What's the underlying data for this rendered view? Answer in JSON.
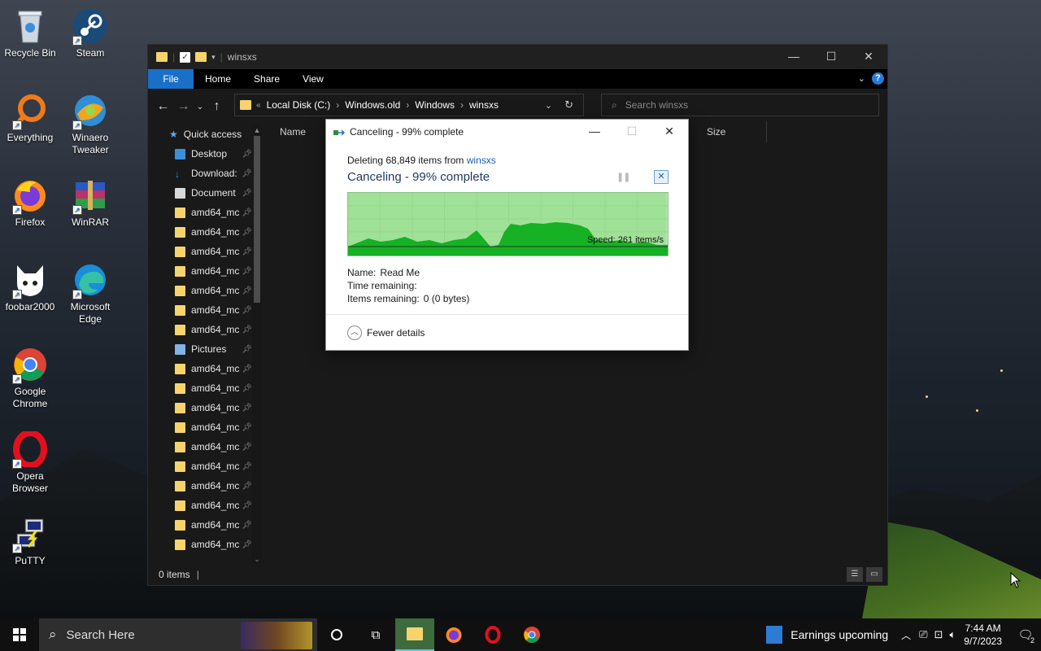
{
  "desktop": {
    "icons": [
      {
        "label": "Recycle Bin"
      },
      {
        "label": "Steam"
      },
      {
        "label": "Everything"
      },
      {
        "label": "Winaero Tweaker"
      },
      {
        "label": "Firefox"
      },
      {
        "label": "WinRAR"
      },
      {
        "label": "foobar2000"
      },
      {
        "label": "Microsoft Edge"
      },
      {
        "label": "Google Chrome"
      },
      {
        "label": "Opera Browser"
      },
      {
        "label": "PuTTY"
      }
    ]
  },
  "explorer": {
    "title": "winsxs",
    "ribbon": {
      "file": "File",
      "home": "Home",
      "share": "Share",
      "view": "View"
    },
    "address": {
      "overflow": "«",
      "path": [
        "Local Disk (C:)",
        "Windows.old",
        "Windows",
        "winsxs"
      ]
    },
    "search_placeholder": "Search winsxs",
    "columns": {
      "name": "Name",
      "size": "Size"
    },
    "sidebar": {
      "quick_access": "Quick access",
      "items": [
        {
          "label": "Desktop",
          "icon": "desktop-icon"
        },
        {
          "label": "Download:",
          "icon": "download-icon"
        },
        {
          "label": "Document",
          "icon": "document-icon"
        },
        {
          "label": "amd64_mc"
        },
        {
          "label": "amd64_mc"
        },
        {
          "label": "amd64_mc"
        },
        {
          "label": "amd64_mc"
        },
        {
          "label": "amd64_mc"
        },
        {
          "label": "amd64_mc"
        },
        {
          "label": "amd64_mc"
        },
        {
          "label": "Pictures",
          "icon": "pictures-icon"
        },
        {
          "label": "amd64_mc"
        },
        {
          "label": "amd64_mc"
        },
        {
          "label": "amd64_mc"
        },
        {
          "label": "amd64_mc"
        },
        {
          "label": "amd64_mc"
        },
        {
          "label": "amd64_mc"
        },
        {
          "label": "amd64_mc"
        },
        {
          "label": "amd64_mc"
        },
        {
          "label": "amd64_mc"
        },
        {
          "label": "amd64_mc"
        }
      ]
    },
    "status": "0 items"
  },
  "dialog": {
    "title": "Canceling - 99% complete",
    "subtitle_prefix": "Deleting 68,849 items from ",
    "subtitle_link": "winsxs",
    "heading": "Canceling - 99% complete",
    "progress_percent": 99,
    "speed": "Speed: 261 items/s",
    "name_label": "Name:",
    "name_value": "Read Me",
    "time_label": "Time remaining:",
    "time_value": "",
    "items_label": "Items remaining:",
    "items_value": "0 (0 bytes)",
    "fewer_details": "Fewer details",
    "graph_color": "#16b124",
    "graph_bg": "#b4e6ad"
  },
  "taskbar": {
    "search_placeholder": "Search Here",
    "news": "Earnings upcoming",
    "time": "7:44 AM",
    "date": "9/7/2023",
    "notification_count": "2"
  }
}
